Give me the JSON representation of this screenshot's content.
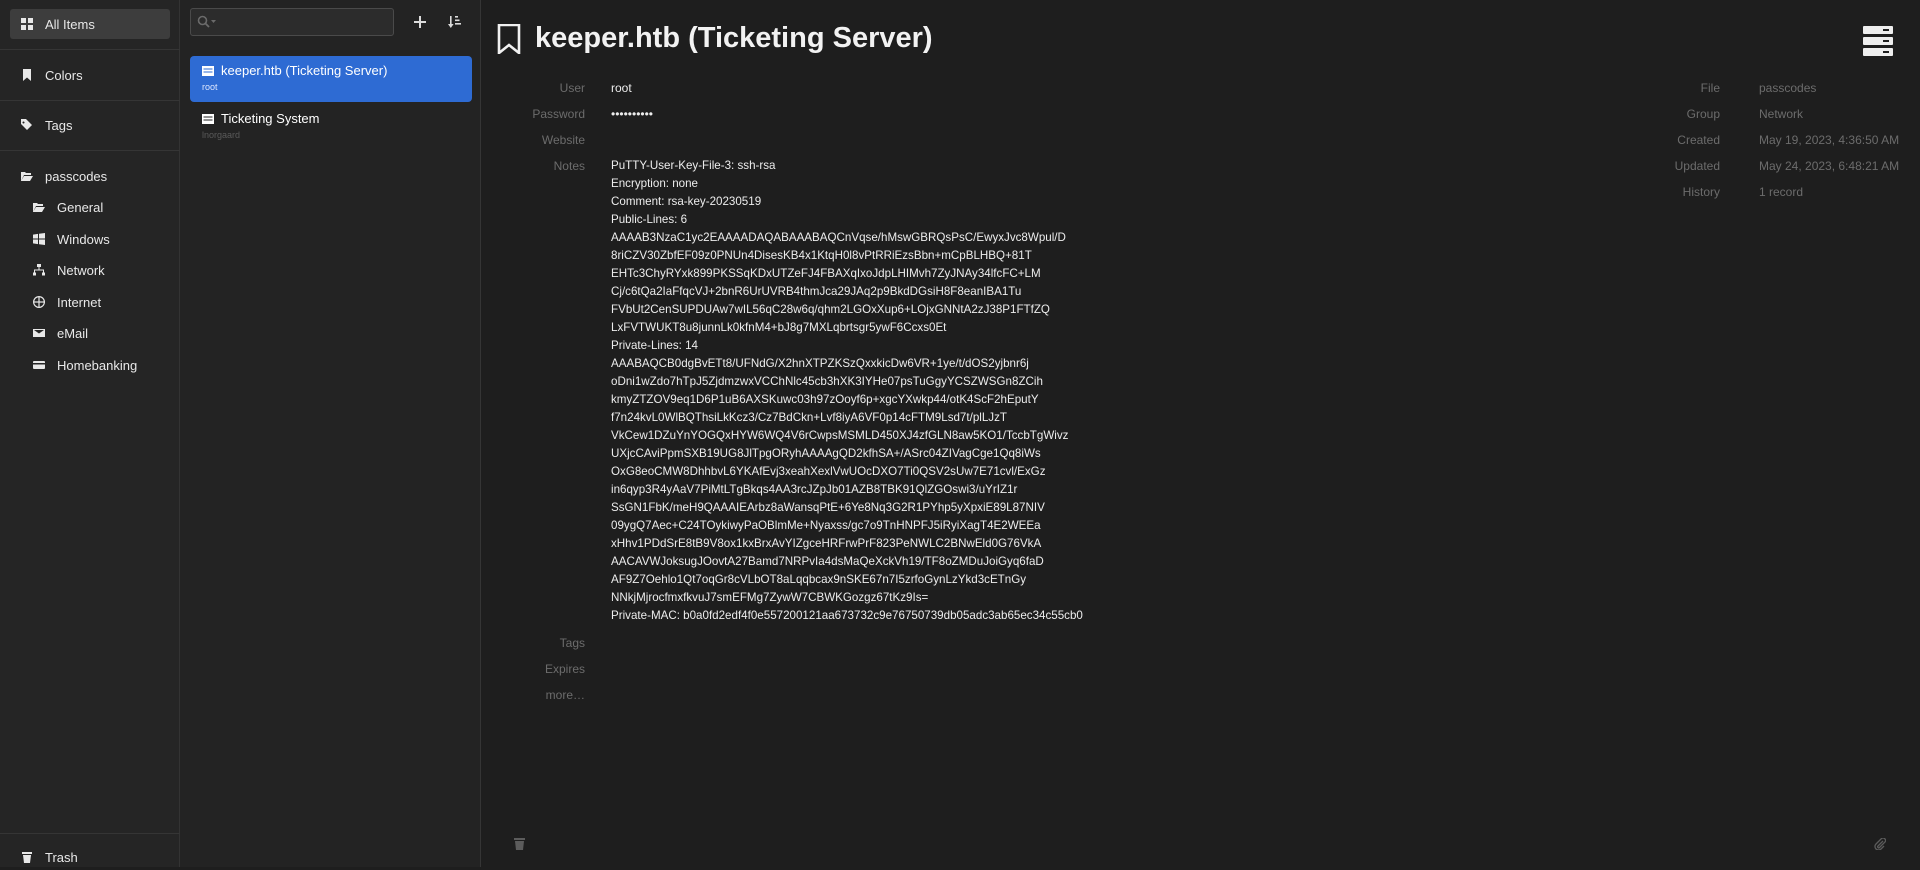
{
  "sidebar": {
    "all_items": "All Items",
    "colors": "Colors",
    "tags": "Tags",
    "group_root": "passcodes",
    "groups": [
      "General",
      "Windows",
      "Network",
      "Internet",
      "eMail",
      "Homebanking"
    ],
    "trash": "Trash"
  },
  "list": {
    "search_placeholder": "",
    "entries": [
      {
        "title": "keeper.htb (Ticketing Server)",
        "subtitle": "root"
      },
      {
        "title": "Ticketing System",
        "subtitle": "lnorgaard"
      }
    ]
  },
  "detail": {
    "title": "keeper.htb (Ticketing Server)",
    "fields": {
      "user_label": "User",
      "user_value": "root",
      "password_label": "Password",
      "password_value": "••••••••••",
      "website_label": "Website",
      "website_value": "",
      "notes_label": "Notes",
      "tags_label": "Tags",
      "expires_label": "Expires",
      "more_label": "more…"
    },
    "notes": [
      "PuTTY-User-Key-File-3: ssh-rsa",
      "Encryption: none",
      "Comment: rsa-key-20230519",
      "Public-Lines: 6",
      "AAAAB3NzaC1yc2EAAAADAQABAAABAQCnVqse/hMswGBRQsPsC/EwyxJvc8Wpul/D",
      "8riCZV30ZbfEF09z0PNUn4DisesKB4x1KtqH0l8vPtRRiEzsBbn+mCpBLHBQ+81T",
      "EHTc3ChyRYxk899PKSSqKDxUTZeFJ4FBAXqIxoJdpLHIMvh7ZyJNAy34lfcFC+LM",
      "Cj/c6tQa2IaFfqcVJ+2bnR6UrUVRB4thmJca29JAq2p9BkdDGsiH8F8eanIBA1Tu",
      "FVbUt2CenSUPDUAw7wIL56qC28w6q/qhm2LGOxXup6+LOjxGNNtA2zJ38P1FTfZQ",
      "LxFVTWUKT8u8junnLk0kfnM4+bJ8g7MXLqbrtsgr5ywF6Ccxs0Et",
      "Private-Lines: 14",
      "AAABAQCB0dgBvETt8/UFNdG/X2hnXTPZKSzQxxkicDw6VR+1ye/t/dOS2yjbnr6j",
      "oDni1wZdo7hTpJ5ZjdmzwxVCChNlc45cb3hXK3IYHe07psTuGgyYCSZWSGn8ZCih",
      "kmyZTZOV9eq1D6P1uB6AXSKuwc03h97zOoyf6p+xgcYXwkp44/otK4ScF2hEputY",
      "f7n24kvL0WlBQThsiLkKcz3/Cz7BdCkn+Lvf8iyA6VF0p14cFTM9Lsd7t/plLJzT",
      "VkCew1DZuYnYOGQxHYW6WQ4V6rCwpsMSMLD450XJ4zfGLN8aw5KO1/TccbTgWivz",
      "UXjcCAviPpmSXB19UG8JlTpgORyhAAAAgQD2kfhSA+/ASrc04ZIVagCge1Qq8iWs",
      "OxG8eoCMW8DhhbvL6YKAfEvj3xeahXexlVwUOcDXO7Ti0QSV2sUw7E71cvl/ExGz",
      "in6qyp3R4yAaV7PiMtLTgBkqs4AA3rcJZpJb01AZB8TBK91QlZGOswi3/uYrIZ1r",
      "SsGN1FbK/meH9QAAAIEArbz8aWansqPtE+6Ye8Nq3G2R1PYhp5yXpxiE89L87NIV",
      "09ygQ7Aec+C24TOykiwyPaOBlmMe+Nyaxss/gc7o9TnHNPFJ5iRyiXagT4E2WEEa",
      "xHhv1PDdSrE8tB9V8ox1kxBrxAvYIZgceHRFrwPrF823PeNWLC2BNwEld0G76VkA",
      "AACAVWJoksugJOovtA27Bamd7NRPvIa4dsMaQeXckVh19/TF8oZMDuJoiGyq6faD",
      "AF9Z7Oehlo1Qt7oqGr8cVLbOT8aLqqbcax9nSKE67n7I5zrfoGynLzYkd3cETnGy",
      "NNkjMjrocfmxfkvuJ7smEFMg7ZywW7CBWKGozgz67tKz9Is=",
      "Private-MAC: b0a0fd2edf4f0e557200121aa673732c9e76750739db05adc3ab65ec34c55cb0"
    ],
    "meta": {
      "file_label": "File",
      "file_value": "passcodes",
      "group_label": "Group",
      "group_value": "Network",
      "created_label": "Created",
      "created_value": "May 19, 2023, 4:36:50 AM",
      "updated_label": "Updated",
      "updated_value": "May 24, 2023, 6:48:21 AM",
      "history_label": "History",
      "history_value": "1 record"
    }
  }
}
